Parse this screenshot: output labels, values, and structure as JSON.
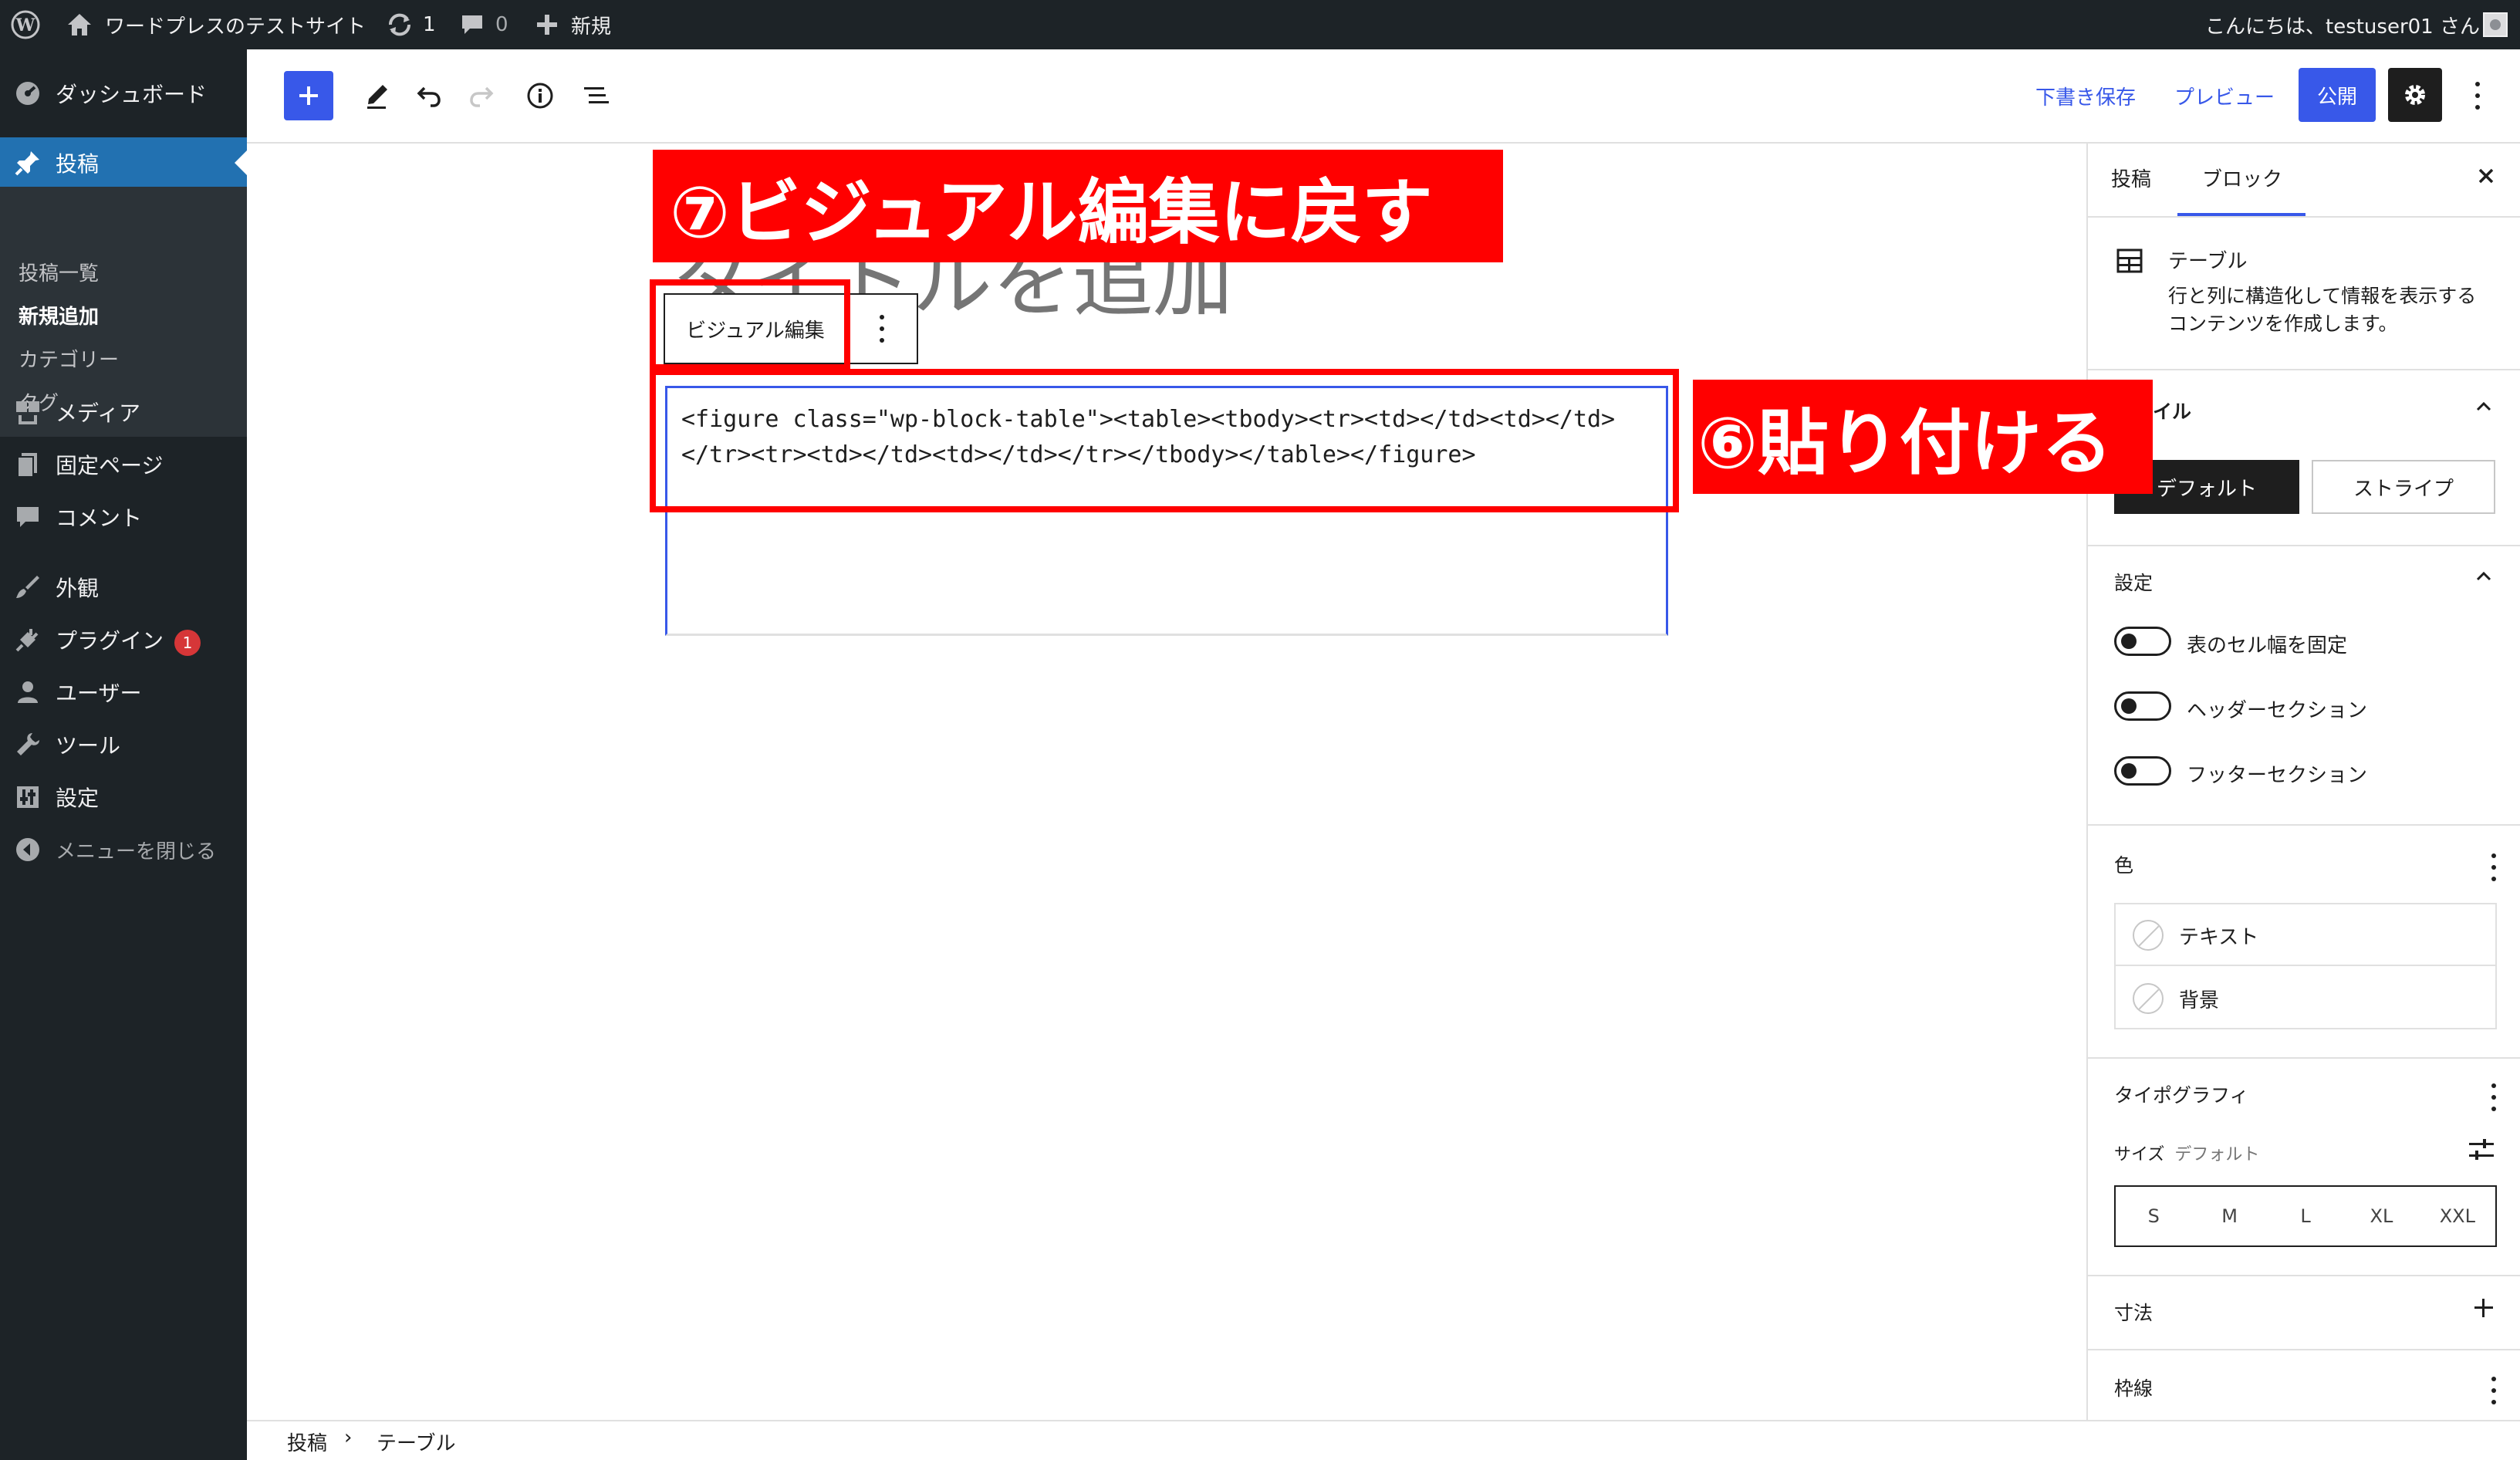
{
  "admin_bar": {
    "site_name": "ワードプレスのテストサイト",
    "updates_count": "1",
    "comments_count": "0",
    "new_label": "新規",
    "greeting": "こんにちは、testuser01 さん"
  },
  "sidebar": {
    "dashboard": "ダッシュボード",
    "posts": "投稿",
    "posts_sub": [
      "投稿一覧",
      "新規追加",
      "カテゴリー",
      "タグ"
    ],
    "media": "メディア",
    "pages": "固定ページ",
    "comments": "コメント",
    "appearance": "外観",
    "plugins": "プラグイン",
    "plugins_badge": "1",
    "users": "ユーザー",
    "tools": "ツール",
    "settings": "設定",
    "collapse": "メニューを閉じる"
  },
  "toolbar": {
    "save_draft": "下書き保存",
    "preview": "プレビュー",
    "publish": "公開"
  },
  "editor": {
    "title_placeholder": "タイトルを追加",
    "visual_edit_button": "ビジュアル編集",
    "html_line1": "<figure class=\"wp-block-table\"><table><tbody><tr><td></td><td></td>",
    "html_line2": "</tr><tr><td></td><td></td></tr></tbody></table></figure>"
  },
  "inspector": {
    "tab_post": "投稿",
    "tab_block": "ブロック",
    "block_name": "テーブル",
    "block_desc_1": "行と列に構造化して情報を表示する",
    "block_desc_2": "コンテンツを作成します。",
    "style_title": "スタイル",
    "style_default": "デフォルト",
    "style_stripe": "ストライプ",
    "settings_title": "設定",
    "toggles": [
      "表のセル幅を固定",
      "ヘッダーセクション",
      "フッターセクション"
    ],
    "color_title": "色",
    "color_text": "テキスト",
    "color_background": "背景",
    "typography_title": "タイポグラフィ",
    "size_label": "サイズ",
    "size_value": "デフォルト",
    "sizes": [
      "S",
      "M",
      "L",
      "XL",
      "XXL"
    ],
    "dimensions_title": "寸法",
    "border_title": "枠線"
  },
  "breadcrumb": {
    "root": "投稿",
    "separator": "›",
    "current": "テーブル"
  },
  "annotations": {
    "step7": "⑦ビジュアル編集に戻す",
    "step6": "⑥貼り付ける"
  },
  "colors": {
    "admin_dark": "#1d2327",
    "wp_blue": "#2271b1",
    "editor_blue": "#3858e9",
    "annotation_red": "#ff0000"
  }
}
